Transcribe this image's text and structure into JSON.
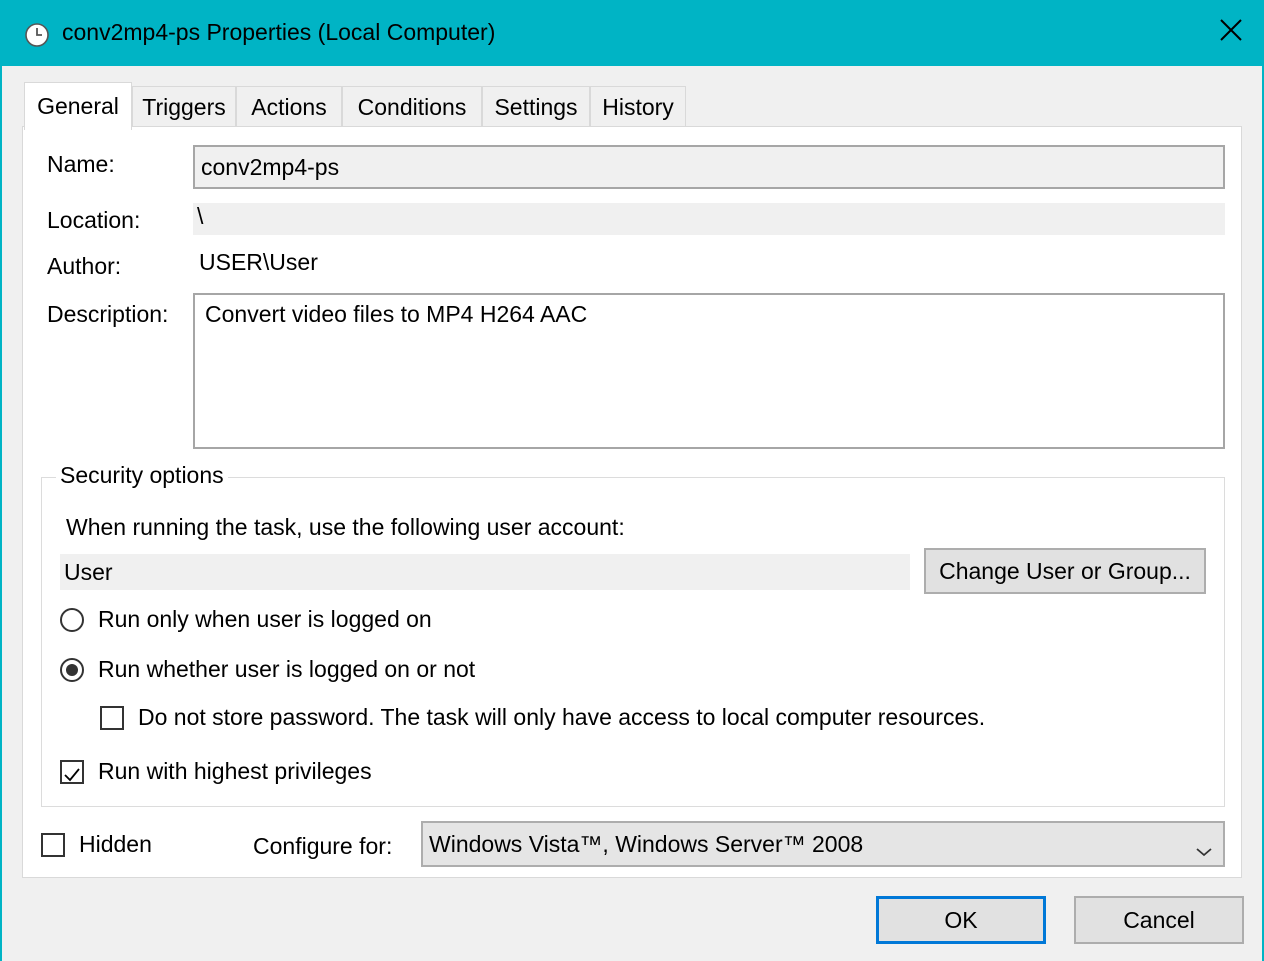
{
  "window": {
    "title": "conv2mp4-ps Properties (Local Computer)",
    "accent_color": "#00b4c5",
    "title_icon": "clock-icon",
    "close_icon": "close-icon"
  },
  "tabs": [
    {
      "label": "General",
      "active": true
    },
    {
      "label": "Triggers",
      "active": false
    },
    {
      "label": "Actions",
      "active": false
    },
    {
      "label": "Conditions",
      "active": false
    },
    {
      "label": "Settings",
      "active": false
    },
    {
      "label": "History",
      "active": false
    }
  ],
  "general": {
    "name_label": "Name:",
    "name_value": "conv2mp4-ps",
    "location_label": "Location:",
    "location_value": "\\",
    "author_label": "Author:",
    "author_value": "USER\\User",
    "description_label": "Description:",
    "description_value": "Convert video files to MP4 H264 AAC"
  },
  "security": {
    "group_title": "Security options",
    "account_prompt": "When running the task, use the following user account:",
    "account_value": "User",
    "change_button": "Change User or Group...",
    "radio_logged_on": "Run only when user is logged on",
    "radio_logged_on_selected": false,
    "radio_whether": "Run whether user is logged on or not",
    "radio_whether_selected": true,
    "no_store_password": "Do not store password.  The task will only have access to local computer resources.",
    "no_store_password_checked": false,
    "highest_privileges": "Run with highest privileges",
    "highest_privileges_checked": true
  },
  "bottom": {
    "hidden_label": "Hidden",
    "hidden_checked": false,
    "configure_label": "Configure for:",
    "configure_value": "Windows Vista™, Windows Server™ 2008"
  },
  "buttons": {
    "ok": "OK",
    "cancel": "Cancel",
    "default_border_color": "#0078d7"
  }
}
